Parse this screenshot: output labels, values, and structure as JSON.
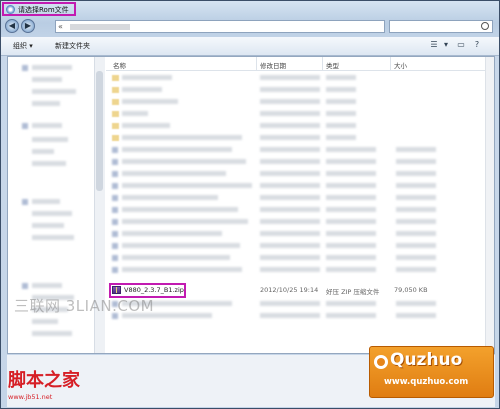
{
  "window": {
    "title": "请选择Rom文件"
  },
  "navigation": {
    "back": "◀",
    "forward": "▶",
    "address_chevron": "«"
  },
  "toolbar": {
    "organize": "组织 ▾",
    "new_folder": "新建文件夹",
    "view_icon": "view-list-icon",
    "help_icon": "help-icon"
  },
  "columns": {
    "name": "名称",
    "modified": "修改日期",
    "type": "类型",
    "size": "大小"
  },
  "file": {
    "name": "V880_2.3.7_B1.zip",
    "modified": "2012/10/25 19:14",
    "type": "好压 ZIP 压缩文件",
    "size": "79,050 KB"
  },
  "watermark": "三联网 3LIAN.COM",
  "logos": {
    "left_big": "脚本之家",
    "left_small": "www.jb51.net",
    "right_brand": "Quzhuo",
    "right_url": "www.quzhuo.com"
  },
  "colors": {
    "highlight": "#c21bb1",
    "zip_icon": "#5b3a96"
  }
}
